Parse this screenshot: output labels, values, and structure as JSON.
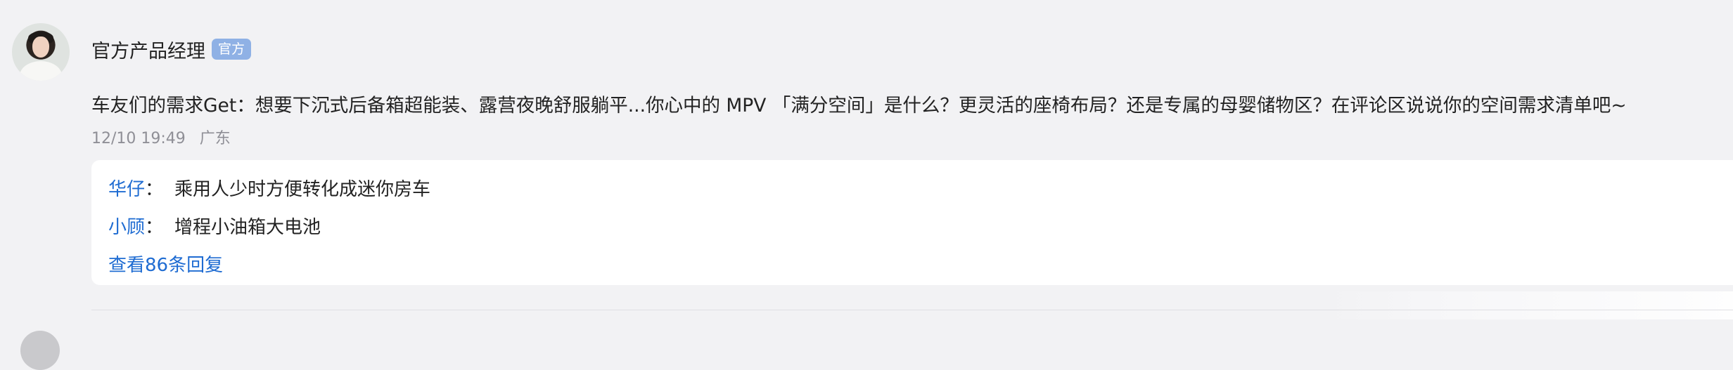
{
  "comment": {
    "author": {
      "name": "官方产品经理",
      "badge": "官方",
      "avatar_icon": "person-avatar-icon"
    },
    "text": "车友们的需求Get：想要下沉式后备箱超能装、露营夜晚舒服躺平...你心中的 MPV 「满分空间」是什么？更灵活的座椅布局？还是专属的母婴储物区？在评论区说说你的空间需求清单吧~",
    "time": "12/10 19:49",
    "location": "广东",
    "replies": [
      {
        "user": "华仔",
        "colon": "：",
        "text": "乘用人少时方便转化成迷你房车"
      },
      {
        "user": "小顾",
        "colon": "：",
        "text": "增程小油箱大电池"
      }
    ],
    "view_more": "查看86条回复"
  },
  "colors": {
    "page_background": "#f2f2f4",
    "reply_background": "#ffffff",
    "link_blue": "#1f6cd2",
    "badge_blue": "#8fb1e5",
    "meta_gray": "#8f8f96"
  }
}
